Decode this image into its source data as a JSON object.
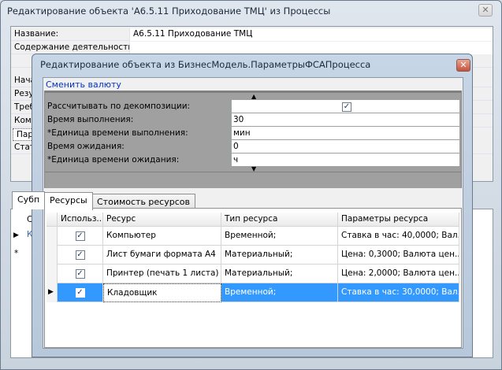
{
  "back_window": {
    "title": "Редактирование объекта 'А6.5.11 Приходование ТМЦ' из Процессы",
    "close_glyph": "✕",
    "rows": [
      {
        "label": "Название:",
        "value": "А6.5.11 Приходование ТМЦ"
      },
      {
        "label": "Содержание деятельности:",
        "value": ""
      },
      {
        "label": "",
        "value": ""
      },
      {
        "label": "Нача",
        "value": ""
      },
      {
        "label": "Резу",
        "value": ""
      },
      {
        "label": "Треб",
        "value": ""
      },
      {
        "label": "Комм",
        "value": ""
      },
      {
        "label": "Пара",
        "value": ""
      },
      {
        "label": "Стат",
        "value": ""
      }
    ],
    "bottom_tab": "Субп",
    "grid_header_partial": "С",
    "grid_row_partial": "К",
    "new_row_marker": "*"
  },
  "dialog": {
    "title": "Редактирование объекта  из БизнесМодель.ПараметрыФСАПроцесса",
    "close_glyph": "✕",
    "link": "Сменить валюту",
    "scroll_up": "▲",
    "scroll_down": "▼",
    "properties": [
      {
        "label": "Рассчитывать по декомпозиции:",
        "value": "",
        "checkbox": true,
        "checked": "✓"
      },
      {
        "label": "Время выполнения:",
        "value": "30"
      },
      {
        "label": "*Единица времени выполнения:",
        "value": "мин"
      },
      {
        "label": "Время ожидания:",
        "value": "0"
      },
      {
        "label": "*Единица времени ожидания:",
        "value": "ч"
      }
    ],
    "tabs": [
      {
        "label": "Ресурсы"
      },
      {
        "label": "Стоимость ресурсов"
      }
    ],
    "grid": {
      "columns": [
        "Использ...",
        "Ресурс",
        "Тип ресурса",
        "Параметры ресурса"
      ],
      "rows": [
        {
          "used": "✓",
          "resource": "Компьютер",
          "type": "Временной;",
          "params": "Ставка в час: 40,0000; Вал..."
        },
        {
          "used": "✓",
          "resource": "Лист бумаги формата А4",
          "type": "Материальный;",
          "params": "Цена: 0,3000; Валюта цен..."
        },
        {
          "used": "✓",
          "resource": "Принтер (печать 1 листа)",
          "type": "Материальный;",
          "params": "Цена: 2,0000; Валюта цен..."
        },
        {
          "used": "✓",
          "resource": "Кладовщик",
          "type": "Временной;",
          "params": "Ставка в час: 30,0000; Вал..."
        }
      ],
      "current_row_marker": "▶"
    }
  }
}
